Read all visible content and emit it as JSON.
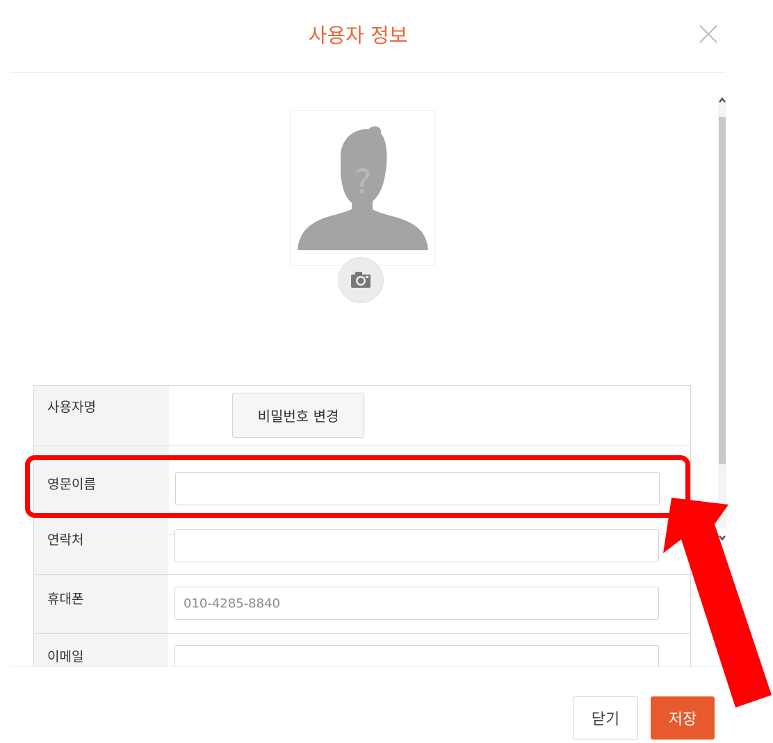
{
  "modal": {
    "title": "사용자 정보",
    "accent_color": "#e8683a",
    "close_icon": "close-icon"
  },
  "avatar": {
    "icon": "person-placeholder-icon",
    "camera_icon": "camera-icon"
  },
  "form": {
    "username": {
      "label": "사용자명",
      "change_password_label": "비밀번호 변경"
    },
    "english_name": {
      "label": "영문이름",
      "value": ""
    },
    "contact": {
      "label": "연락처",
      "value": ""
    },
    "mobile": {
      "label": "휴대폰",
      "placeholder": "010-4285-8840"
    },
    "email": {
      "label": "이메일",
      "value": ""
    }
  },
  "footer": {
    "close_label": "닫기",
    "save_label": "저장",
    "save_color": "#e8592d"
  },
  "annotation": {
    "highlight_color": "#ff0000"
  }
}
